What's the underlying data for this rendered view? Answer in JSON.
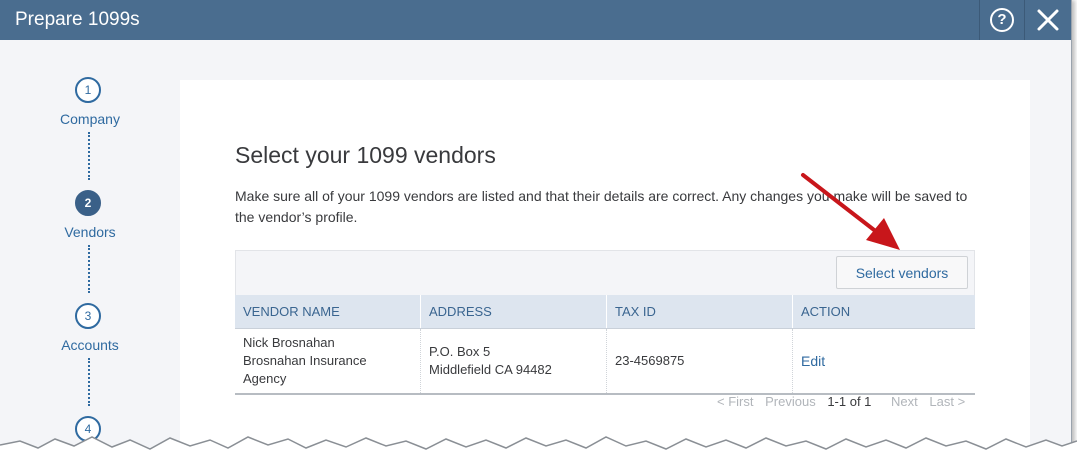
{
  "window": {
    "title": "Prepare 1099s",
    "help_icon": "help-circle-icon",
    "close_icon": "close-icon"
  },
  "stepper": {
    "steps": [
      {
        "number": "1",
        "label": "Company",
        "active": false
      },
      {
        "number": "2",
        "label": "Vendors",
        "active": true
      },
      {
        "number": "3",
        "label": "Accounts",
        "active": false
      },
      {
        "number": "4",
        "label": "",
        "active": false
      }
    ]
  },
  "main": {
    "heading": "Select your 1099 vendors",
    "description": "Make sure all of your 1099 vendors are listed and that their details are correct. Any changes you make will be saved to the vendor’s profile.",
    "select_vendors_label": "Select vendors",
    "table": {
      "columns": [
        "VENDOR NAME",
        "ADDRESS",
        "TAX ID",
        "ACTION"
      ],
      "rows": [
        {
          "vendor_name_line1": "Nick Brosnahan",
          "vendor_name_line2": "Brosnahan Insurance Agency",
          "address_line1": "P.O. Box 5",
          "address_line2": "Middlefield CA 94482",
          "tax_id": "23-4569875",
          "action": "Edit"
        }
      ]
    },
    "pagination": {
      "first": "< First",
      "previous": "Previous",
      "range": "1-1 of 1",
      "next": "Next",
      "last": "Last >"
    }
  },
  "colors": {
    "titlebar": "#4a6d8f",
    "accent": "#2f6aa0",
    "annotation_arrow": "#c8161b"
  }
}
